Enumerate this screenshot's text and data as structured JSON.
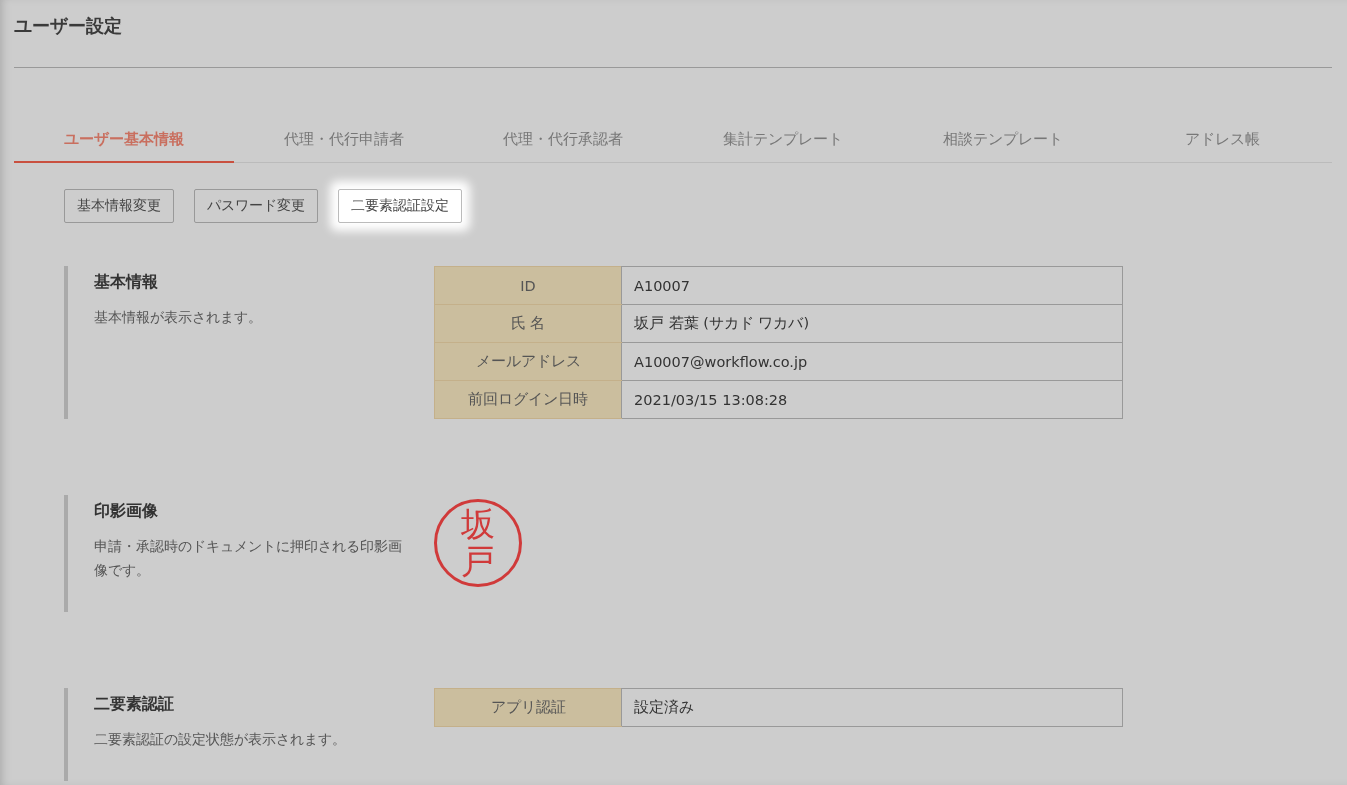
{
  "page": {
    "title": "ユーザー設定"
  },
  "tabs": [
    {
      "label": "ユーザー基本情報",
      "selected": true
    },
    {
      "label": "代理・代行申請者",
      "selected": false
    },
    {
      "label": "代理・代行承認者",
      "selected": false
    },
    {
      "label": "集計テンプレート",
      "selected": false
    },
    {
      "label": "相談テンプレート",
      "selected": false
    },
    {
      "label": "アドレス帳",
      "selected": false
    }
  ],
  "buttons": [
    {
      "label": "基本情報変更",
      "highlighted": false
    },
    {
      "label": "パスワード変更",
      "highlighted": false
    },
    {
      "label": "二要素認証設定",
      "highlighted": true
    }
  ],
  "sections": [
    {
      "kind": "table",
      "title": "基本情報",
      "description": "基本情報が表示されます。",
      "rows": [
        {
          "label": "ID",
          "value": "A10007"
        },
        {
          "label": "氏 名",
          "value": "坂戸 若葉 (サカド ワカバ)"
        },
        {
          "label": "メールアドレス",
          "value": "A10007@workflow.co.jp"
        },
        {
          "label": "前回ログイン日時",
          "value": "2021/03/15 13:08:28"
        }
      ]
    },
    {
      "kind": "stamp",
      "title": "印影画像",
      "description": "申請・承認時のドキュメントに押印される印影画像です。",
      "stamp_text": "坂戸"
    },
    {
      "kind": "table",
      "title": "二要素認証",
      "description": "二要素認証の設定状態が表示されます。",
      "rows": [
        {
          "label": "アプリ認証",
          "value": "設定済み"
        }
      ]
    }
  ]
}
